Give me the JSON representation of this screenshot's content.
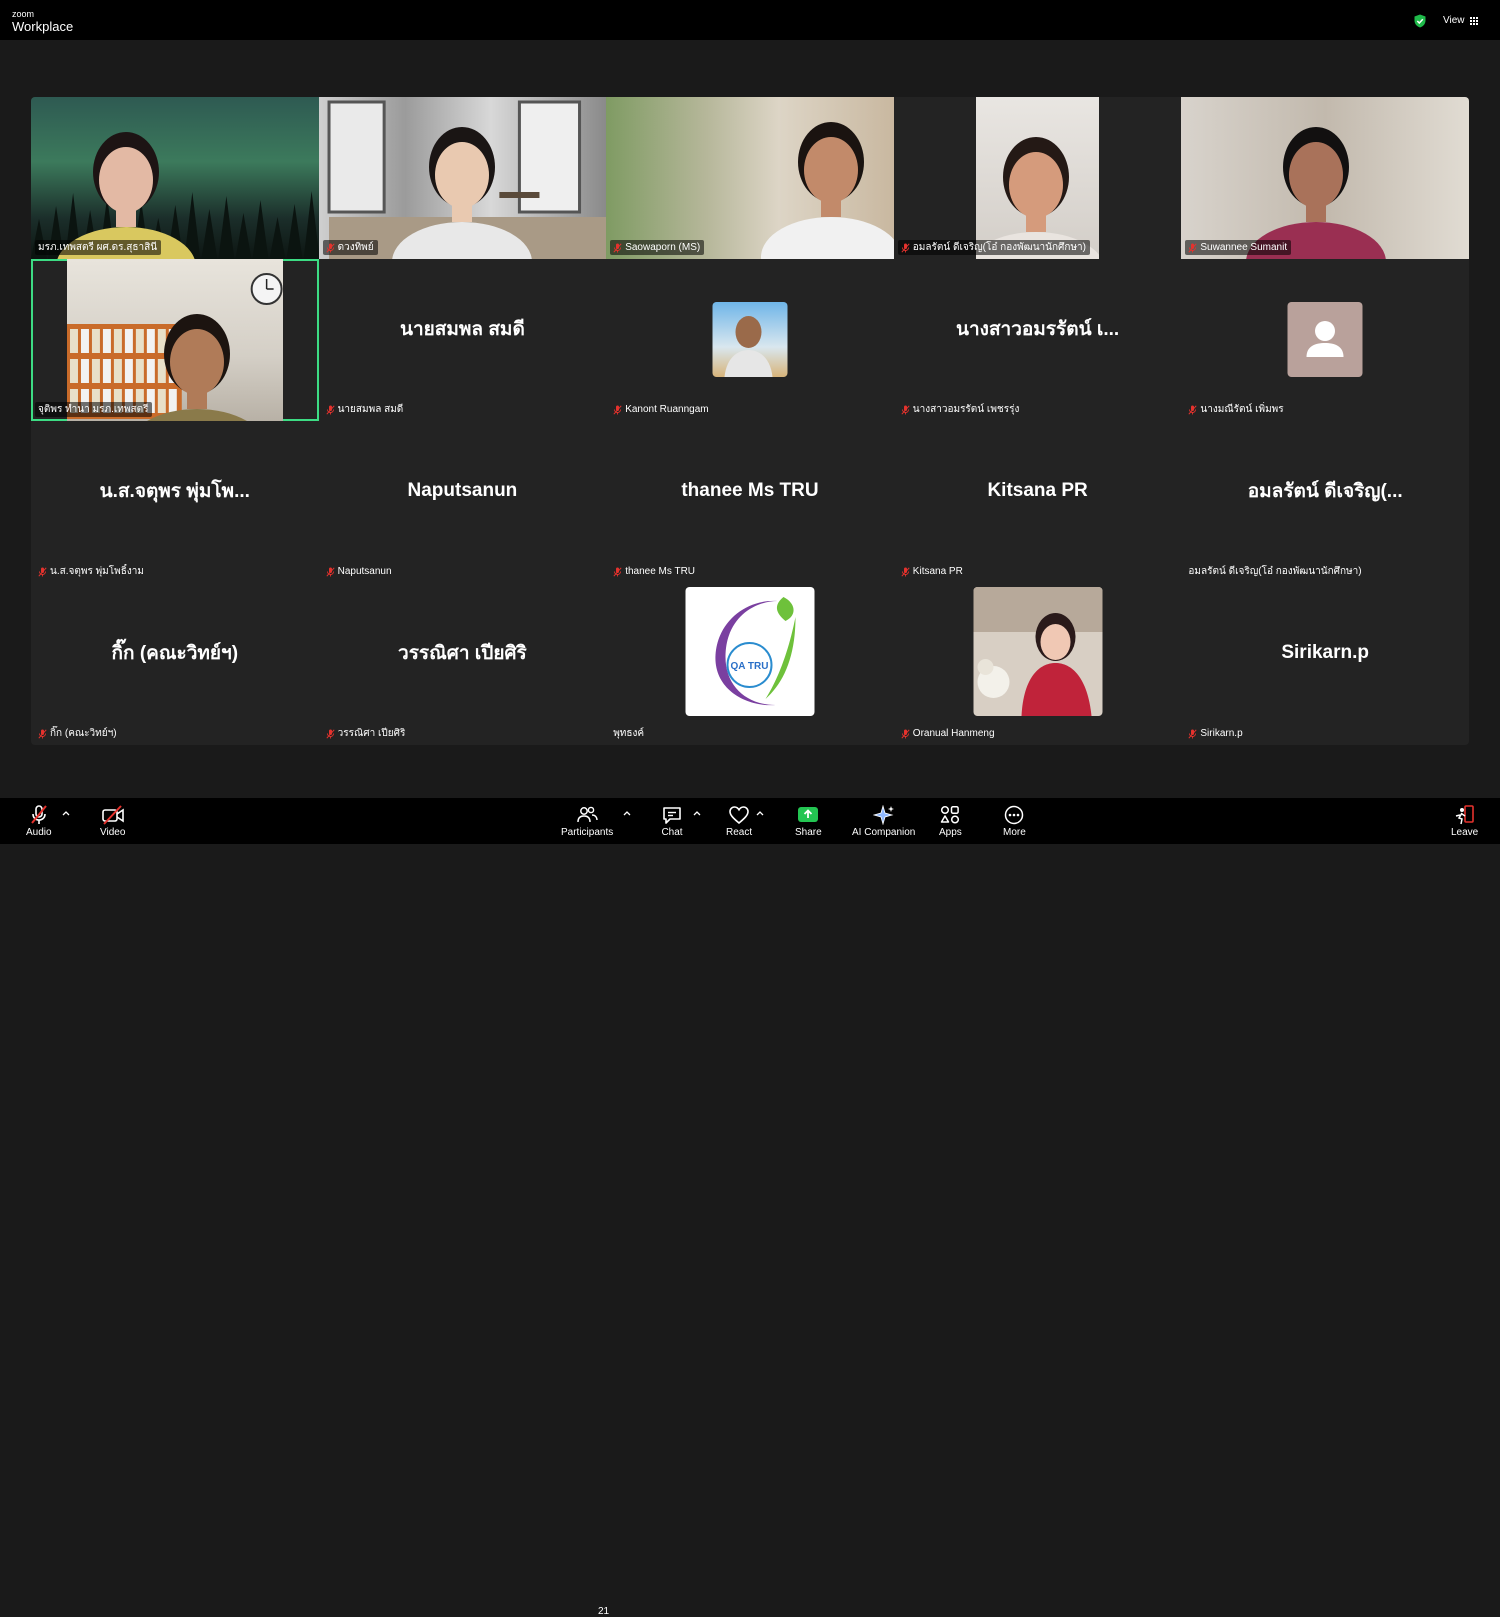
{
  "app": {
    "brand_small": "zoom",
    "brand_large": "Workplace",
    "view_label": "View"
  },
  "tiles": [
    {
      "name": "มรภ.เทพสตรี ผศ.ดร.สุธาสินี",
      "type": "video",
      "muted": false
    },
    {
      "name": "ดวงทิพย์",
      "type": "video",
      "muted": true
    },
    {
      "name": "Saowaporn (MS)",
      "type": "video",
      "muted": true
    },
    {
      "name": "อมลรัตน์ ดีเจริญ(โอ๋ กองพัฒนานักศึกษา)",
      "type": "video",
      "muted": true
    },
    {
      "name": "Suwannee Sumanit",
      "type": "video",
      "muted": true
    },
    {
      "name": "จุติพร ทำนา มรภ.เทพสตรี",
      "type": "video",
      "muted": false,
      "active": true
    },
    {
      "name": "นายสมพล สมดี",
      "display": "นายสมพล สมดี",
      "type": "text",
      "muted": true
    },
    {
      "name": "Kanont Ruanngam",
      "type": "photo",
      "muted": true
    },
    {
      "name": "นางสาวอมรรัตน์ เพชรรุ่ง",
      "display": "นางสาวอมรรัตน์ เ...",
      "type": "text",
      "muted": true
    },
    {
      "name": "นางมณีรัตน์ เพิ่มพร",
      "type": "placeholder",
      "muted": true
    },
    {
      "name": "น.ส.จตุพร  พุ่มโพธิ์งาม",
      "display": "น.ส.จตุพร  พุ่มโพ...",
      "type": "text",
      "muted": true
    },
    {
      "name": "Naputsanun",
      "display": "Naputsanun",
      "type": "text",
      "muted": true
    },
    {
      "name": "thanee Ms TRU",
      "display": "thanee Ms TRU",
      "type": "text",
      "muted": true
    },
    {
      "name": "Kitsana PR",
      "display": "Kitsana PR",
      "type": "text",
      "muted": true
    },
    {
      "name": "อมลรัตน์ ดีเจริญ(โอ๋ กองพัฒนานักศึกษา)",
      "display": "อมลรัตน์ ดีเจริญ(...",
      "type": "text",
      "muted": false
    },
    {
      "name": "กิ๊ก (คณะวิทย์ฯ)",
      "display": "กิ๊ก (คณะวิทย์ฯ)",
      "type": "text",
      "muted": true
    },
    {
      "name": "วรรณิศา เปียศิริ",
      "display": "วรรณิศา เปียศิริ",
      "type": "text",
      "muted": true
    },
    {
      "name": "พุทธงค์",
      "type": "logo",
      "muted": false,
      "logo_text": "QA TRU"
    },
    {
      "name": "Oranual Hanmeng",
      "type": "photo2",
      "muted": true
    },
    {
      "name": "Sirikarn.p",
      "display": "Sirikarn.p",
      "type": "text",
      "muted": true
    }
  ],
  "toolbar": {
    "audio": "Audio",
    "video": "Video",
    "participants": "Participants",
    "participants_count": "21",
    "chat": "Chat",
    "react": "React",
    "share": "Share",
    "ai": "AI Companion",
    "apps": "Apps",
    "more": "More",
    "leave": "Leave"
  },
  "colors": {
    "accent_green": "#3ddc84",
    "share_green": "#23c552",
    "muted_red": "#e5322d",
    "shield_green": "#1fba4a"
  }
}
